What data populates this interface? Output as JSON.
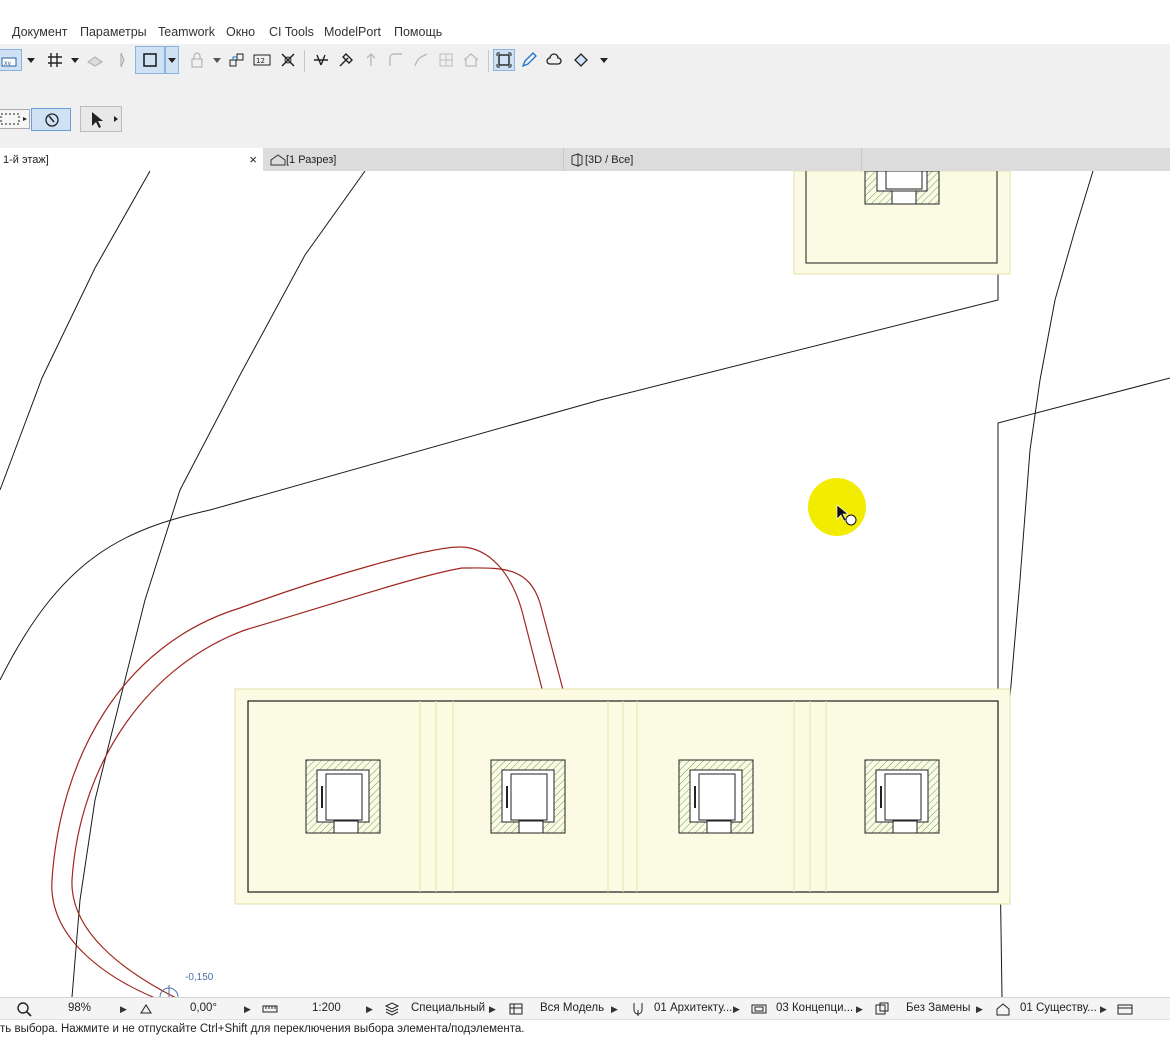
{
  "menu": {
    "items": [
      {
        "label": "Документ"
      },
      {
        "label": "Параметры"
      },
      {
        "label": "Teamwork"
      },
      {
        "label": "Окно"
      },
      {
        "label": "CI Tools"
      },
      {
        "label": "ModelPort"
      },
      {
        "label": "Помощь"
      }
    ]
  },
  "tabs": [
    {
      "label": "1-й этаж]",
      "icon": "floor-plan-icon",
      "active": true,
      "close": "×"
    },
    {
      "label": "[1 Разрез]",
      "icon": "section-icon",
      "active": false
    },
    {
      "label": "[3D / Все]",
      "icon": "3d-icon",
      "active": false
    }
  ],
  "canvas": {
    "elevation_label": "-0,150",
    "colors": {
      "line": "#1a1a1a",
      "path_red": "#a0281e",
      "slab": "#f7f6d2",
      "slab_edge": "#e3e2a4",
      "hatch": "#6b9f6b",
      "cursor_highlight": "#f2ec00"
    }
  },
  "status": {
    "zoom": "98%",
    "angle": "0,00°",
    "scale": "1:200",
    "layer_combo": "Специальный",
    "model_view": "Вся Модель",
    "pen_set": "01 Архитекту...",
    "mvo": "03 Концепци...",
    "override": "Без Замены",
    "renovation": "01 Существу..."
  },
  "hint": "ть выбора. Нажмите и не отпускайте Ctrl+Shift для переключения выбора элемента/подэлемента."
}
